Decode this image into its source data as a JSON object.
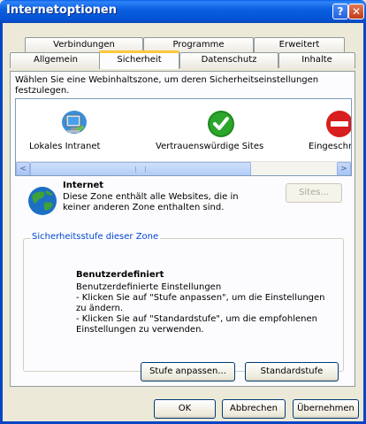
{
  "window": {
    "title": "Internetoptionen",
    "help_label": "?",
    "close_label": "✕"
  },
  "tabs": {
    "back_row": [
      "Verbindungen",
      "Programme",
      "Erweitert"
    ],
    "front_row": [
      "Allgemein",
      "Sicherheit",
      "Datenschutz",
      "Inhalte"
    ],
    "active": "Sicherheit"
  },
  "security": {
    "intro": "Wählen Sie eine Webinhaltszone, um deren Sicherheitseinstellungen festzulegen.",
    "zones": [
      {
        "label": "Lokales Intranet",
        "icon": "intranet-computer-icon"
      },
      {
        "label": "Vertrauenswürdige Sites",
        "icon": "trusted-check-icon"
      },
      {
        "label": "Eingeschrä",
        "icon": "restricted-sign-icon"
      }
    ],
    "scroll_left": "<",
    "scroll_right": ">",
    "selected_zone_title": "Internet",
    "selected_zone_desc": "Diese Zone enthält alle Websites, die in keiner anderen Zone enthalten sind.",
    "sites_button": "Sites...",
    "level_group_label": "Sicherheitsstufe dieser Zone",
    "level_title": "Benutzerdefiniert",
    "level_text": "Benutzerdefinierte Einstellungen\n- Klicken Sie auf \"Stufe anpassen\", um die Einstellungen zu ändern.\n- Klicken Sie auf \"Standardstufe\", um die empfohlenen Einstellungen zu verwenden.",
    "custom_level_button": "Stufe anpassen...",
    "default_level_button": "Standardstufe"
  },
  "footer": {
    "ok": "OK",
    "cancel": "Abbrechen",
    "apply": "Übernehmen"
  },
  "colors": {
    "titlebar": "#0553d4",
    "frame": "#0846c4",
    "active_tab_accent": "#ffc83c",
    "group_label": "#0046d5"
  }
}
